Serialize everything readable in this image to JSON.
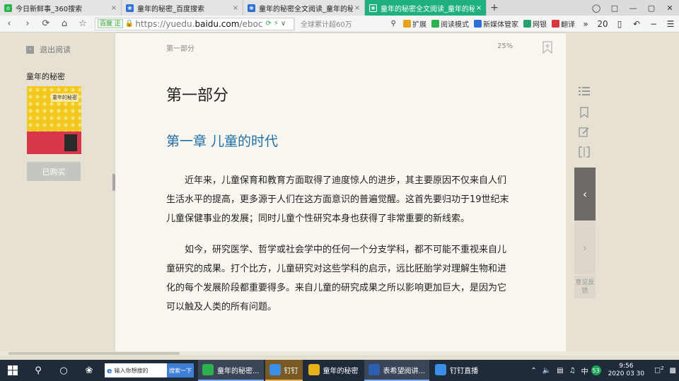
{
  "browser": {
    "tabs": [
      {
        "title": "今日新鲜事_360搜索",
        "icon": "green-o",
        "color": "#2bb24c",
        "active": false
      },
      {
        "title": "童年的秘密_百度搜索",
        "icon": "paw",
        "color": "#2e6fd6",
        "active": false
      },
      {
        "title": "童年的秘密全文阅读_童年的秘密",
        "icon": "paw",
        "color": "#2e6fd6",
        "active": false
      },
      {
        "title": "童年的秘密全文阅读_童年的秘密",
        "icon": "paw",
        "color": "#ffffff",
        "active": true
      }
    ],
    "new_tab": "+",
    "address": {
      "badge": "百度 正",
      "url_prefix": "https://yuedu.",
      "url_domain": "baidu.com",
      "url_suffix": "/eboc"
    },
    "search_placeholder": "全球累计超60万",
    "tools": [
      {
        "label": "扩展",
        "color": "#e8a21a"
      },
      {
        "label": "阅读模式",
        "color": "#2bb24c"
      },
      {
        "label": "新媒体管家",
        "color": "#2e6fd6"
      },
      {
        "label": "网银",
        "color": "#26a26b"
      },
      {
        "label": "翻译",
        "color": "#d9363e"
      }
    ],
    "zoom_more": "»",
    "zoom_count": "20"
  },
  "reader": {
    "exit_label": "退出阅读",
    "book_title": "童年的秘密",
    "cover_title": "童年的秘密",
    "bought_label": "已购买",
    "header_part": "第一部分",
    "progress": "25%",
    "part_title": "第一部分",
    "chapter_title": "第一章 儿童的时代",
    "paragraphs": [
      "近年来，儿童保育和教育方面取得了迪度惊人的进步，其主要原因不仅来自人们生活水平的提高，更多源于人们在这方面意识的普遍觉醒。这首先要归功于19世纪末儿童保健事业的发展；同时儿童个性研究本身也获得了非常重要的新线索。",
      "如今，研究医学、哲学或社会学中的任何一个分支学科，都不可能不重视来自儿童研究的成果。打个比方，儿童研究对这些学科的启示，远比胚胎学对理解生物和进化的每个发展阶段都重要得多。来自儿童的研究成果之所以影响更加巨大，是因为它可以触及人类的所有问题。"
    ],
    "feedback_label": "意见反馈",
    "scroll_position": 0.02
  },
  "taskbar": {
    "search_placeholder": "输入你想搜的",
    "search_button": "搜索一下",
    "apps": [
      {
        "label": "童年的秘密...",
        "color": "#2bb24c",
        "state": "open"
      },
      {
        "label": "钉钉",
        "color": "#3a8ee6",
        "state": "act"
      },
      {
        "label": "童年的秘密",
        "color": "#e8b21a",
        "state": "normal"
      },
      {
        "label": "表希望阅讲...",
        "color": "#2b5fb4",
        "state": "open"
      },
      {
        "label": "钉钉直播",
        "color": "#3a8ee6",
        "state": "normal"
      }
    ],
    "ime": "中",
    "badge_num": "53",
    "time": "9:56",
    "date": "2020 03 30",
    "notif_count": "2"
  }
}
